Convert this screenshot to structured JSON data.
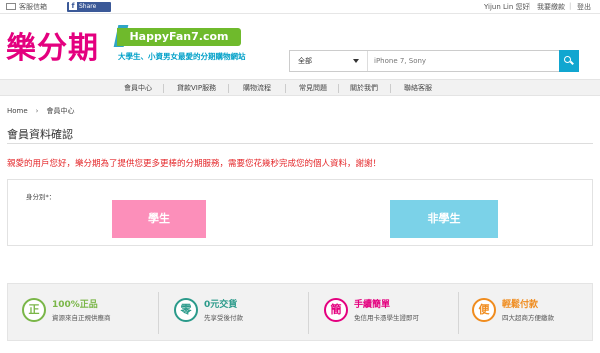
{
  "topbar": {
    "customer_service": "客服信箱",
    "fb_share": "Share",
    "user_greeting": "Yijun Lin 您好",
    "my_account": "我要繳款",
    "logout": "登出"
  },
  "logo": {
    "brand_cn": "樂分期",
    "brand_en": "HappyFan7.com",
    "tagline": "大學生、小資男女最愛的分期購物網站"
  },
  "search": {
    "category": "全部",
    "placeholder": "iPhone 7, Sony"
  },
  "nav": {
    "items": [
      "會員中心",
      "貸款VIP服務",
      "購物流程",
      "常見問題",
      "關於我們",
      "聯絡客服"
    ]
  },
  "breadcrumb": {
    "home": "Home",
    "current": "會員中心"
  },
  "page": {
    "title": "會員資料確認",
    "notice": "親愛的用戶您好，樂分期為了提供您更多更棒的分期服務，需要您花幾秒完成您的個人資料，謝謝！",
    "identity_label": "身分別*：",
    "student_button": "學生",
    "non_student_button": "非學生"
  },
  "features": [
    {
      "icon_char": "正",
      "title": "100%正品",
      "desc": "資源來自正規供應商",
      "color": "#7ab648"
    },
    {
      "icon_char": "零",
      "title": "0元交貨",
      "desc": "先享受後付款",
      "color": "#2a9a8a"
    },
    {
      "icon_char": "簡",
      "title": "手續簡單",
      "desc": "免信用卡憑學生證即可",
      "color": "#e4007f"
    },
    {
      "icon_char": "便",
      "title": "輕鬆付款",
      "desc": "四大超商方便繳款",
      "color": "#f08c1e"
    }
  ]
}
